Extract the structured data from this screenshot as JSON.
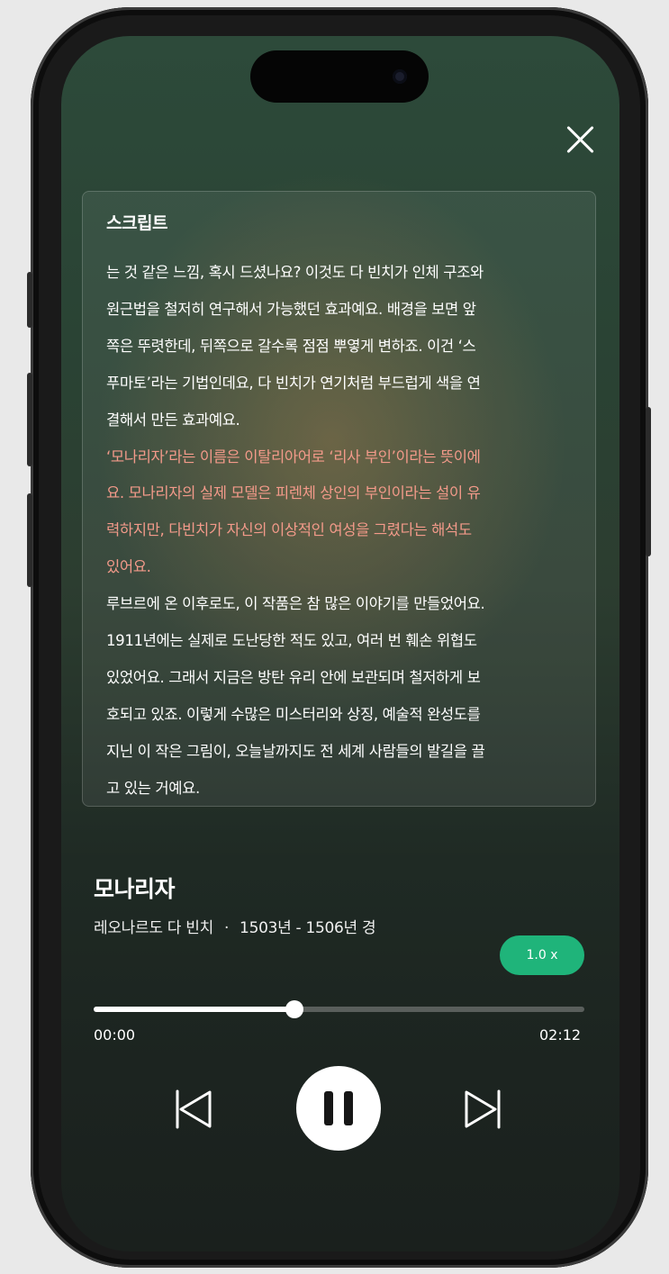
{
  "header": {
    "close_icon": "close-icon"
  },
  "script": {
    "title": "스크립트",
    "lines": [
      {
        "text": "는 것 같은 느낌, 혹시 드셨나요? 이것도 다 빈치가 인체 구조와",
        "highlight": false
      },
      {
        "text": "원근법을 철저히 연구해서 가능했던 효과예요. 배경을 보면 앞",
        "highlight": false
      },
      {
        "text": "쪽은 뚜렷한데, 뒤쪽으로 갈수록 점점 뿌옇게 변하죠. 이건 ‘스",
        "highlight": false
      },
      {
        "text": "푸마토’라는 기법인데요, 다 빈치가 연기처럼 부드럽게 색을 연",
        "highlight": false
      },
      {
        "text": "결해서 만든 효과예요.",
        "highlight": false
      },
      {
        "text": "‘모나리자’라는 이름은 이탈리아어로 ‘리사 부인’이라는 뜻이에",
        "highlight": true
      },
      {
        "text": "요. 모나리자의 실제 모델은 피렌체 상인의 부인이라는 설이 유",
        "highlight": true
      },
      {
        "text": "력하지만, 다빈치가 자신의 이상적인 여성을 그렸다는 해석도",
        "highlight": true
      },
      {
        "text": "있어요.",
        "highlight": true
      },
      {
        "text": "루브르에 온 이후로도, 이 작품은 참 많은 이야기를 만들었어요.",
        "highlight": false
      },
      {
        "text": "1911년에는 실제로 도난당한 적도 있고, 여러 번 훼손 위협도",
        "highlight": false
      },
      {
        "text": "있었어요. 그래서 지금은 방탄 유리 안에 보관되며 철저하게 보",
        "highlight": false
      },
      {
        "text": "호되고 있죠. 이렇게 수많은 미스터리와 상징, 예술적 완성도를",
        "highlight": false
      },
      {
        "text": "지닌 이 작은 그림이, 오늘날까지도 전 세계 사람들의 발길을 끌",
        "highlight": false
      },
      {
        "text": "고 있는 거예요.",
        "highlight": false
      }
    ]
  },
  "track": {
    "title": "모나리자",
    "artist": "레오나르도 다 빈치",
    "separator": "·",
    "period": "1503년 - 1506년 경"
  },
  "player": {
    "speed_label": "1.0 x",
    "progress": 0.41,
    "time_current": "00:00",
    "time_total": "02:12",
    "is_playing": true,
    "icons": {
      "prev": "skip-previous-icon",
      "play": "pause-icon",
      "next": "skip-next-icon"
    }
  },
  "colors": {
    "accent": "#1fb47a",
    "highlight_text": "#f39a8a"
  }
}
